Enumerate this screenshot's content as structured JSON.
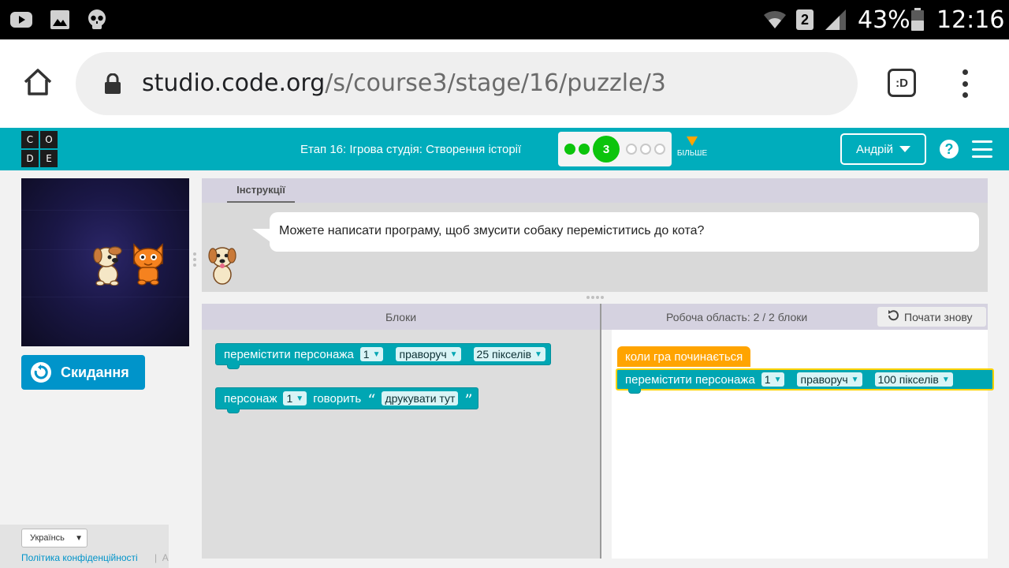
{
  "status_bar": {
    "icons_left": [
      "youtube-icon",
      "gallery-icon",
      "skull-icon"
    ],
    "icons_right": [
      "wifi-icon",
      "sim-2-icon",
      "signal-icon",
      "battery-icon"
    ],
    "sim_label": "2",
    "battery": "43%",
    "time": "12:16"
  },
  "browser": {
    "url_host": "studio.code.org",
    "url_path": "/s/course3/stage/16/puzzle/3",
    "tab_switcher_label": ":D",
    "icons": [
      "home-icon",
      "lock-icon",
      "tab-switcher-icon",
      "overflow-menu-icon"
    ]
  },
  "header": {
    "logo_letters": [
      "C",
      "O",
      "D",
      "E"
    ],
    "stage_title": "Етап 16: Ігрова студія: Створення історії",
    "progress": {
      "completed": 2,
      "current": "3",
      "remaining": 3
    },
    "more_label": "БІЛЬШЕ",
    "user_name": "Андрій",
    "help_label": "?"
  },
  "game": {
    "reset_label": "Скидання"
  },
  "instructions": {
    "tab_label": "Інструкції",
    "text": "Можете написати програму, щоб змусити собаку переміститись до кота?"
  },
  "blocks_panel": {
    "header": "Блоки",
    "move_block": {
      "label": "перемістити персонажа",
      "actor": "1",
      "direction": "праворуч",
      "distance": "25 пікселів"
    },
    "say_block": {
      "label": "персонаж",
      "actor": "1",
      "verb": "говорить",
      "open_quote": "“",
      "text": "друкувати тут",
      "close_quote": "”"
    }
  },
  "workspace": {
    "header": "Робоча область: 2 / 2 блоки",
    "start_over_label": "Почати знову",
    "event_block": "коли гра починається",
    "move_block": {
      "label": "перемістити персонажа",
      "actor": "1",
      "direction": "праворуч",
      "distance": "100 пікселів"
    }
  },
  "footer": {
    "language": "Українсь",
    "privacy_link": "Політика конфіденційності",
    "separator": "|",
    "truncated": "А"
  },
  "colors": {
    "header_teal": "#00adbc",
    "block_teal": "#00a6b3",
    "event_orange": "#ffa400",
    "progress_green": "#0cc40c",
    "reset_blue": "#0094ca"
  }
}
